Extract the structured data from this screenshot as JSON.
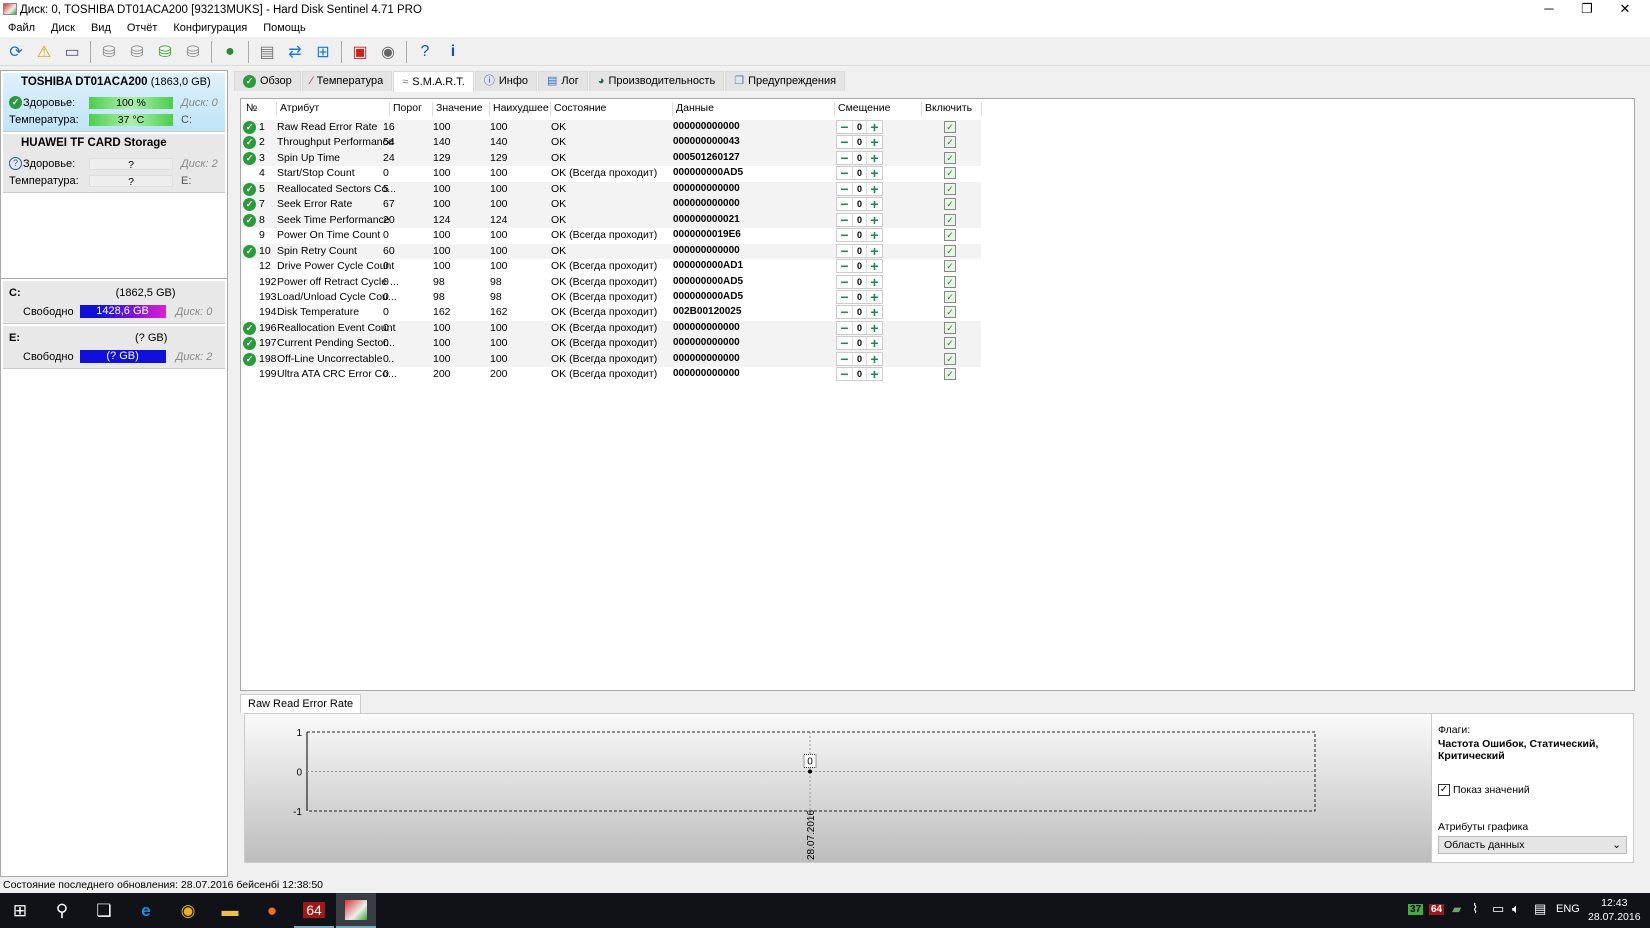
{
  "window": {
    "title": "Диск: 0, TOSHIBA DT01ACA200 [93213MUKS]  -  Hard Disk Sentinel 4.71 PRO",
    "minimize": "─",
    "restore": "❐",
    "close": "✕"
  },
  "menu": [
    "Файл",
    "Диск",
    "Вид",
    "Отчёт",
    "Конфигурация",
    "Помощь"
  ],
  "toolbar_icons": [
    "refresh-icon",
    "alert-icon",
    "disk-info-icon",
    "disk-test-icon",
    "disk-timer-icon",
    "disk-check-icon",
    "disk-search-icon",
    "globe-icon",
    "report-icon",
    "sync-icon",
    "network-icon",
    "monitor-icon",
    "sound-icon",
    "help-icon",
    "info-icon"
  ],
  "disks": [
    {
      "name": "TOSHIBA DT01ACA200",
      "size": "(1863,0 GB)",
      "health_label": "Здоровье:",
      "health": "100 %",
      "disk": "Диск: 0",
      "temp_label": "Температура:",
      "temp": "37 °C",
      "drive": "C:"
    },
    {
      "name": "HUAWEI  TF CARD Storage",
      "size": "",
      "health_label": "Здоровье:",
      "health": "?",
      "disk": "Диск: 2",
      "temp_label": "Температура:",
      "temp": "?",
      "drive": "E:"
    }
  ],
  "volumes": [
    {
      "letter": "C:",
      "size": "(1862,5 GB)",
      "free_label": "Свободно",
      "free": "1428,6 GB",
      "disk": "Диск: 0",
      "free_pct": 77
    },
    {
      "letter": "E:",
      "size": "(? GB)",
      "free_label": "Свободно",
      "free": "(? GB)",
      "disk": "Диск: 2",
      "free_pct": 100
    }
  ],
  "tabs": [
    "Обзор",
    "Температура",
    "S.M.A.R.T.",
    "Инфо",
    "Лог",
    "Производительность",
    "Предупреждения"
  ],
  "columns": [
    "№",
    "Атрибут",
    "Порог",
    "Значение",
    "Наихудшее",
    "Состояние",
    "Данные",
    "Смещение",
    "Включить"
  ],
  "rows": [
    {
      "ok": true,
      "id": "1",
      "attr": "Raw Read Error Rate",
      "thr": "16",
      "val": "100",
      "worst": "100",
      "state": "OK",
      "data": "000000000000",
      "offset": "0"
    },
    {
      "ok": true,
      "id": "2",
      "attr": "Throughput Performance",
      "thr": "54",
      "val": "140",
      "worst": "140",
      "state": "OK",
      "data": "000000000043",
      "offset": "0"
    },
    {
      "ok": true,
      "id": "3",
      "attr": "Spin Up Time",
      "thr": "24",
      "val": "129",
      "worst": "129",
      "state": "OK",
      "data": "000501260127",
      "offset": "0"
    },
    {
      "ok": false,
      "id": "4",
      "attr": "Start/Stop Count",
      "thr": "0",
      "val": "100",
      "worst": "100",
      "state": "OK (Всегда проходит)",
      "data": "000000000AD5",
      "offset": "0"
    },
    {
      "ok": true,
      "id": "5",
      "attr": "Reallocated Sectors Co...",
      "thr": "5",
      "val": "100",
      "worst": "100",
      "state": "OK",
      "data": "000000000000",
      "offset": "0"
    },
    {
      "ok": true,
      "id": "7",
      "attr": "Seek Error Rate",
      "thr": "67",
      "val": "100",
      "worst": "100",
      "state": "OK",
      "data": "000000000000",
      "offset": "0"
    },
    {
      "ok": true,
      "id": "8",
      "attr": "Seek Time Performance",
      "thr": "20",
      "val": "124",
      "worst": "124",
      "state": "OK",
      "data": "000000000021",
      "offset": "0"
    },
    {
      "ok": false,
      "id": "9",
      "attr": "Power On Time Count",
      "thr": "0",
      "val": "100",
      "worst": "100",
      "state": "OK (Всегда проходит)",
      "data": "0000000019E6",
      "offset": "0"
    },
    {
      "ok": true,
      "id": "10",
      "attr": "Spin Retry Count",
      "thr": "60",
      "val": "100",
      "worst": "100",
      "state": "OK",
      "data": "000000000000",
      "offset": "0"
    },
    {
      "ok": false,
      "id": "12",
      "attr": "Drive Power Cycle Count",
      "thr": "0",
      "val": "100",
      "worst": "100",
      "state": "OK (Всегда проходит)",
      "data": "000000000AD1",
      "offset": "0"
    },
    {
      "ok": false,
      "id": "192",
      "attr": "Power off Retract Cycle ...",
      "thr": "0",
      "val": "98",
      "worst": "98",
      "state": "OK (Всегда проходит)",
      "data": "000000000AD5",
      "offset": "0"
    },
    {
      "ok": false,
      "id": "193",
      "attr": "Load/Unload Cycle Cou...",
      "thr": "0",
      "val": "98",
      "worst": "98",
      "state": "OK (Всегда проходит)",
      "data": "000000000AD5",
      "offset": "0"
    },
    {
      "ok": false,
      "id": "194",
      "attr": "Disk Temperature",
      "thr": "0",
      "val": "162",
      "worst": "162",
      "state": "OK (Всегда проходит)",
      "data": "002B00120025",
      "offset": "0"
    },
    {
      "ok": true,
      "id": "196",
      "attr": "Reallocation Event Count",
      "thr": "0",
      "val": "100",
      "worst": "100",
      "state": "OK (Всегда проходит)",
      "data": "000000000000",
      "offset": "0"
    },
    {
      "ok": true,
      "id": "197",
      "attr": "Current Pending Sector...",
      "thr": "0",
      "val": "100",
      "worst": "100",
      "state": "OK (Всегда проходит)",
      "data": "000000000000",
      "offset": "0"
    },
    {
      "ok": true,
      "id": "198",
      "attr": "Off-Line Uncorrectable ...",
      "thr": "0",
      "val": "100",
      "worst": "100",
      "state": "OK (Всегда проходит)",
      "data": "000000000000",
      "offset": "0"
    },
    {
      "ok": false,
      "id": "199",
      "attr": "Ultra ATA CRC Error Co...",
      "thr": "0",
      "val": "200",
      "worst": "200",
      "state": "OK (Всегда проходит)",
      "data": "000000000000",
      "offset": "0"
    }
  ],
  "chart_data": {
    "type": "line",
    "title": "Raw Read Error Rate",
    "ylim": [
      -1,
      1
    ],
    "yticks": [
      "1",
      "0",
      "-1"
    ],
    "x": [
      "28.07.2016"
    ],
    "values": [
      0
    ],
    "point_label": "0"
  },
  "flags_panel": {
    "flags_label": "Флаги:",
    "flags": "Частота Ошибок, Статический, Критический",
    "show_values": "Показ значений",
    "attrs_label": "Атрибуты графика",
    "select_value": "Область данных"
  },
  "status": "Состояние последнего обновления: 28.07.2016 бейсенбі 12:38:50",
  "taskbar": {
    "aida": "64",
    "tray_temp": "37",
    "tray_aida": "64",
    "lang": "ENG",
    "time": "12:43",
    "date": "28.07.2016"
  }
}
